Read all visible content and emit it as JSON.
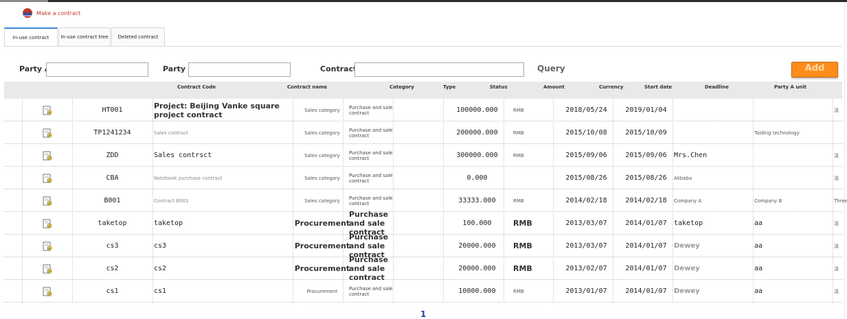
{
  "app": {
    "title": "Make a contract",
    "logo_icon": "mountain-logo-icon",
    "accent": "#c0392b"
  },
  "tabs": [
    {
      "label": "In-use contract",
      "active": true
    },
    {
      "label": "In-use contract tree",
      "active": false
    },
    {
      "label": "Deleted contract",
      "active": false
    }
  ],
  "filters": {
    "party_a_label": "Party A:",
    "party_a_value": "",
    "party_b_label": "Party B:",
    "party_b_value": "",
    "contract_no_label": "Contract No:",
    "contract_no_value": "",
    "query_label": "Query",
    "add_label": "Add",
    "add_color": "#ff8c1a"
  },
  "table": {
    "columns": [
      "Contract Code",
      "Contract name",
      "Category",
      "Type",
      "Status",
      "Amount",
      "Currency",
      "Start date",
      "Deadline",
      "Party A unit"
    ],
    "rows": [
      {
        "code": "HT001",
        "name": "Project: Beijing Vanke square project contract",
        "category": "Sales category",
        "type": "Purchase and sale contract",
        "amount": "100000.000",
        "currency": "RMB",
        "start": "2018/05/24",
        "deadline": "2019/01/04",
        "party_a": "",
        "party_b": "",
        "extra": "法"
      },
      {
        "code": "TP1241234",
        "name": "Sales contract",
        "category": "Sales category",
        "type": "Purchase and sale contract",
        "amount": "200000.000",
        "currency": "RMB",
        "start": "2015/10/08",
        "deadline": "2015/10/09",
        "party_a": "",
        "party_b": "Taiding technology",
        "extra": ""
      },
      {
        "code": "ZDD",
        "name": "Sales contrsct",
        "category": "Sales category",
        "type": "Purchase and sale contract",
        "amount": "300000.000",
        "currency": "RMB",
        "start": "2015/09/06",
        "deadline": "2015/09/06",
        "party_a": "Mrs.Chen",
        "party_b": "",
        "extra": "法"
      },
      {
        "code": "CBA",
        "name": "Notebook purchase contract",
        "category": "Sales category",
        "type": "Purchase and sale contract",
        "amount": "0.000",
        "currency": "",
        "start": "2015/08/26",
        "deadline": "2015/08/26",
        "party_a": "Alibaba",
        "party_b": "",
        "extra": "法"
      },
      {
        "code": "B001",
        "name": "Contract B001",
        "category": "Sales category",
        "type": "Purchase and sale contract",
        "amount": "33333.000",
        "currency": "RMB",
        "start": "2014/02/18",
        "deadline": "2014/02/18",
        "party_a": "Company A",
        "party_b": "Company B",
        "extra": "Three"
      },
      {
        "code": "taketop",
        "name": "taketop",
        "category": "Procurement",
        "type": "Purchase and sale contract",
        "amount": "100.000",
        "currency": "RMB",
        "start": "2013/03/07",
        "deadline": "2014/01/07",
        "party_a": "taketop",
        "party_b": "aa",
        "extra": "法"
      },
      {
        "code": "cs3",
        "name": "cs3",
        "category": "Procurement",
        "type": "Purchase and sale contract",
        "amount": "20000.000",
        "currency": "RMB",
        "start": "2013/03/07",
        "deadline": "2014/01/07",
        "party_a": "Dewey",
        "party_b": "aa",
        "extra": "法"
      },
      {
        "code": "cs2",
        "name": "cs2",
        "category": "Procurement",
        "type": "Purchase and sale contract",
        "amount": "20000.000",
        "currency": "RMB",
        "start": "2013/02/07",
        "deadline": "2014/01/07",
        "party_a": "Dewey",
        "party_b": "aa",
        "extra": "法"
      },
      {
        "code": "cs1",
        "name": "cs1",
        "category": "Procurement",
        "type": "Purchase and sale contract",
        "amount": "10000.000",
        "currency": "RMB",
        "start": "2013/01/07",
        "deadline": "2014/01/07",
        "party_a": "Dewey",
        "party_b": "aa",
        "extra": "法"
      }
    ],
    "row_icon": "edit-document-icon"
  },
  "pager": {
    "current": "1"
  }
}
